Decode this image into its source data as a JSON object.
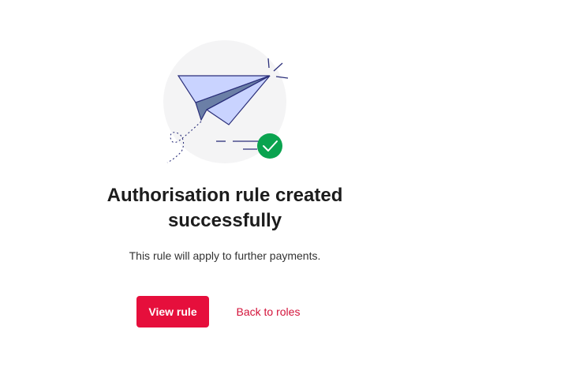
{
  "illustration": {
    "icon": "paper-plane-icon",
    "badge_icon": "check-circle-icon",
    "colors": {
      "circle_bg": "#f4f4f5",
      "plane_light": "#c9d3ff",
      "plane_dark": "#6b7fa6",
      "outline": "#2b2f7a",
      "success": "#0aa34f"
    }
  },
  "content": {
    "title_line1": "Authorisation rule created",
    "title_line2": "successfully",
    "subtitle": "This rule will apply to further payments."
  },
  "actions": {
    "view_rule_label": "View rule",
    "back_to_roles_label": "Back to roles"
  },
  "colors": {
    "primary": "#e60f3c",
    "link": "#d3133a"
  }
}
